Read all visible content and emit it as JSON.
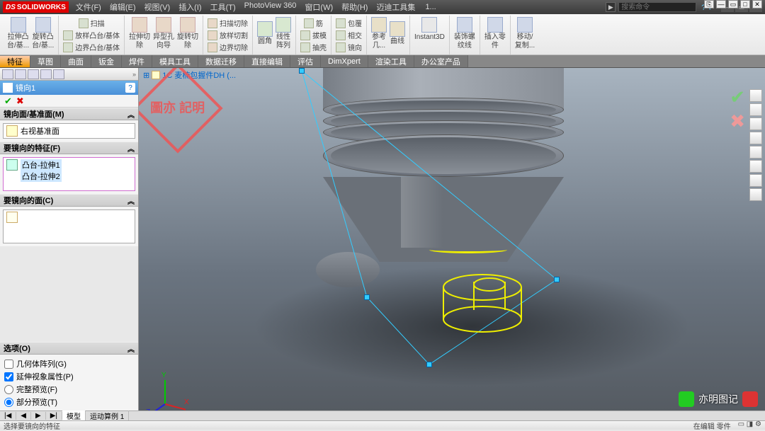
{
  "app": {
    "brand_pre": "DS",
    "brand": "SOLIDWORKS",
    "doc_short": "1..."
  },
  "menu": [
    "文件(F)",
    "编辑(E)",
    "视图(V)",
    "插入(I)",
    "工具(T)",
    "PhotoView 360",
    "窗口(W)",
    "帮助(H)",
    "迈迪工具集"
  ],
  "search_placeholder": "搜索命令",
  "ribbon": {
    "big": [
      {
        "l1": "拉伸凸",
        "l2": "台/基..."
      },
      {
        "l1": "旋转凸",
        "l2": "台/基..."
      }
    ],
    "col1": [
      "扫描",
      "放样凸台/基体",
      "边界凸台/基体"
    ],
    "big2": [
      {
        "l1": "拉伸切",
        "l2": "除"
      },
      {
        "l1": "异型孔",
        "l2": "向导"
      },
      {
        "l1": "旋转切",
        "l2": "除"
      }
    ],
    "col2": [
      "扫描切除",
      "放样切割",
      "边界切除"
    ],
    "big3": [
      {
        "l1": "圆角",
        "l2": ""
      },
      {
        "l1": "线性",
        "l2": "阵列"
      }
    ],
    "col3": [
      "筋",
      "拔模",
      "抽壳"
    ],
    "col4": [
      "包覆",
      "相交",
      "镜向"
    ],
    "big4": [
      {
        "l1": "参考",
        "l2": "几..."
      },
      {
        "l1": "曲线",
        "l2": ""
      }
    ],
    "inst": "Instant3D",
    "col5": [
      "装饰螺",
      "纹线"
    ],
    "col6": [
      "插入零",
      "件"
    ],
    "col7": [
      "移动/",
      "复制..."
    ]
  },
  "tabs": [
    "特征",
    "草图",
    "曲面",
    "钣金",
    "焊件",
    "模具工具",
    "数据迁移",
    "直接编辑",
    "评估",
    "DimXpert",
    "渲染工具",
    "办公室产品"
  ],
  "active_tab": 0,
  "doc_name": "1C 麦楠包握件DH  (...",
  "pm": {
    "title": "镜向1",
    "sec_plane": "镜向面/基准面(M)",
    "plane_value": "右视基准面",
    "sec_features": "要镜向的特征(F)",
    "feature_items": [
      "凸台-拉伸1",
      "凸台-拉伸2"
    ],
    "sec_faces": "要镜向的面(C)",
    "sec_options": "选项(O)",
    "opt_geom": "几何体阵列(G)",
    "opt_visual": "延伸视象属性(P)",
    "opt_full": "完整预览(F)",
    "opt_partial": "部分预览(T)"
  },
  "model_tabs": {
    "nav": [
      "|◀",
      "◀",
      "▶",
      "▶|"
    ],
    "tabs": [
      "模型",
      "运动算例 1"
    ]
  },
  "status": {
    "left": "选择要镜向的特征",
    "mode": "在编辑 零件",
    "extra": ""
  },
  "triad": {
    "x": "X",
    "y": "Y",
    "z": "Z"
  },
  "watermark": "圖亦\n記明",
  "corner": "亦明图记"
}
